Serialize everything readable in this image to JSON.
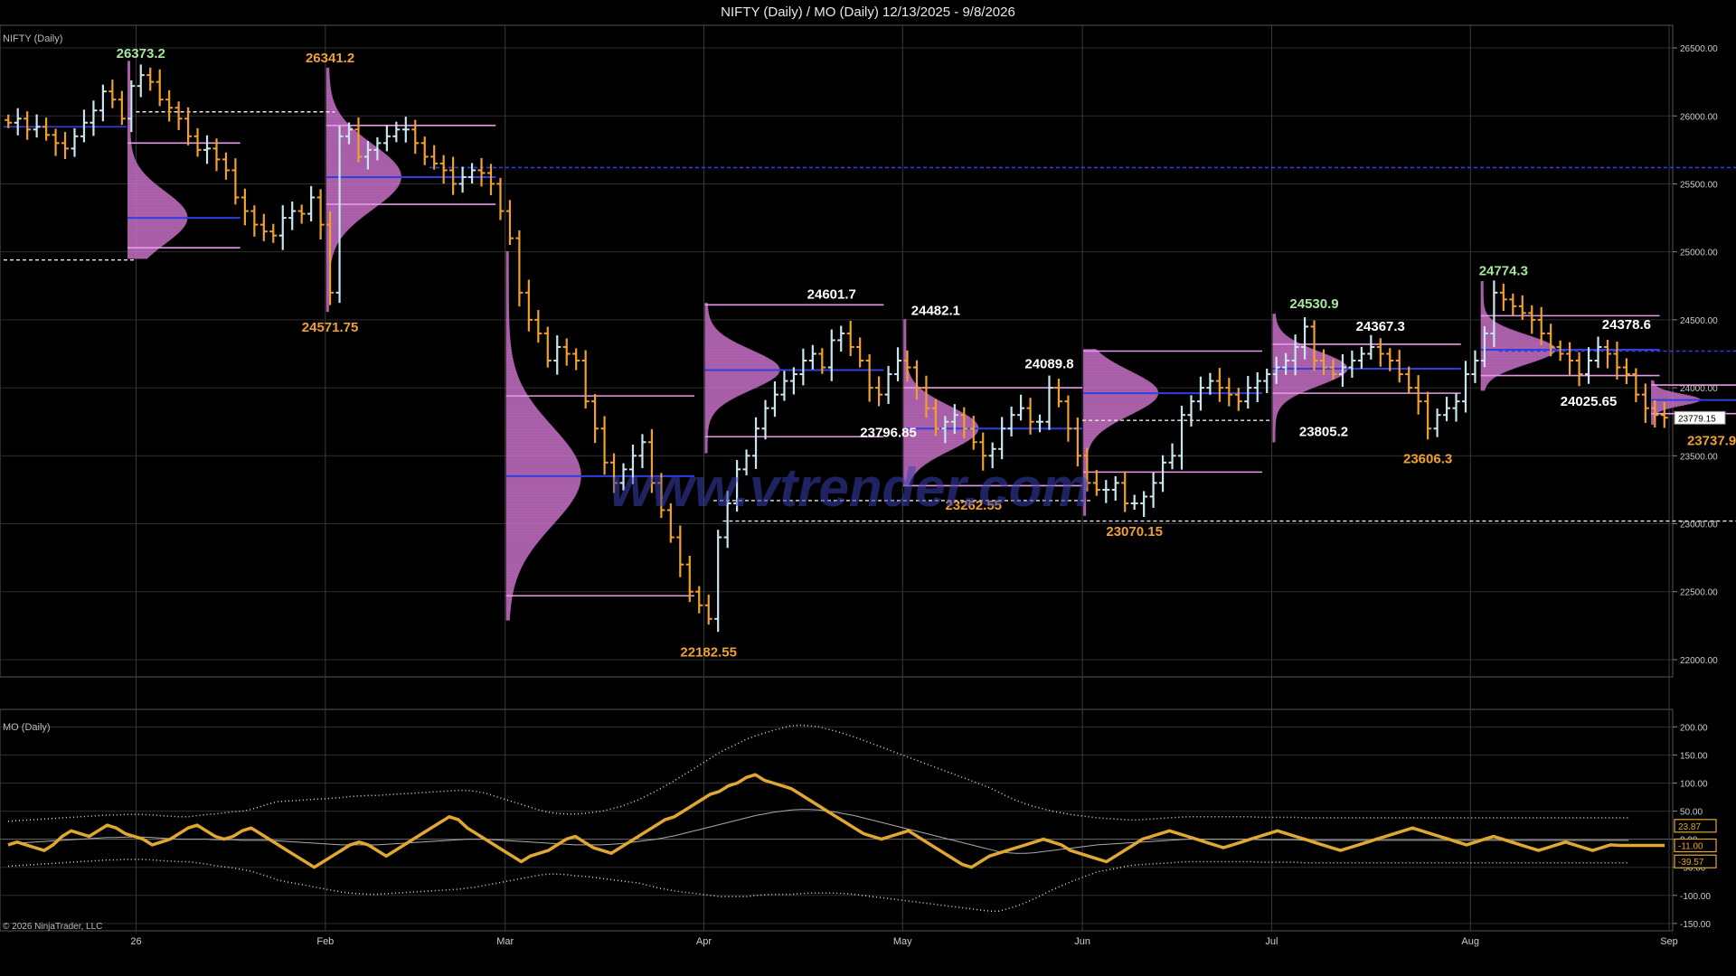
{
  "window": {
    "title": "NIFTY (Daily) / MO (Daily)  12/13/2025 - 9/8/2026"
  },
  "colors": {
    "background": "#000000",
    "grid": "#3a3a3a",
    "bar_up": "#c9e6ee",
    "bar_down": "#f0a030",
    "profile": "#c872c8",
    "poc": "#2f3fe0",
    "value_area": "#e89ae8",
    "mo_line": "#e0a830",
    "mo_band": "#d8d8d8",
    "label_white": "#ffffff",
    "label_orange": "#f0a030",
    "label_green": "#a8e6a0"
  },
  "watermark": "www.vtrender.com",
  "copyright": "© 2026 NinjaTrader, LLC",
  "chart_data": [
    {
      "type": "candlestick",
      "panel_label": "NIFTY (Daily)",
      "ylim": [
        21900,
        26600
      ],
      "y_ticks": [
        "26500.00",
        "26000.00",
        "25500.00",
        "25000.00",
        "24500.00",
        "24000.00",
        "23500.00",
        "23000.00",
        "22500.00",
        "22000.00"
      ],
      "x_ticks": [
        "26",
        "Feb",
        "Mar",
        "Apr",
        "May",
        "Jun",
        "Jul",
        "Aug",
        "Sep"
      ],
      "last_price": "23779.15",
      "annotations": [
        {
          "text": "26373.2",
          "day": 14,
          "price": 26373.2,
          "color": "green",
          "pos": "above"
        },
        {
          "text": "26341.2",
          "day": 34,
          "price": 26341.2,
          "color": "orange",
          "pos": "above"
        },
        {
          "text": "24571.75",
          "day": 34,
          "price": 24571.75,
          "color": "orange",
          "pos": "below"
        },
        {
          "text": "24601.7",
          "day": 87,
          "price": 24601.7,
          "color": "white",
          "pos": "above"
        },
        {
          "text": "24482.1",
          "day": 98,
          "price": 24482.1,
          "color": "white",
          "pos": "above"
        },
        {
          "text": "23796.85",
          "day": 93,
          "price": 23796.85,
          "color": "white",
          "pos": "below"
        },
        {
          "text": "24089.8",
          "day": 110,
          "price": 24089.8,
          "color": "white",
          "pos": "above"
        },
        {
          "text": "23262.55",
          "day": 102,
          "price": 23262.55,
          "color": "orange",
          "pos": "below"
        },
        {
          "text": "22182.55",
          "day": 74,
          "price": 22182.55,
          "color": "orange",
          "pos": "below"
        },
        {
          "text": "23070.15",
          "day": 119,
          "price": 23070.15,
          "color": "orange",
          "pos": "below"
        },
        {
          "text": "24530.9",
          "day": 138,
          "price": 24530.9,
          "color": "green",
          "pos": "above"
        },
        {
          "text": "23805.2",
          "day": 139,
          "price": 23805.2,
          "color": "white",
          "pos": "below"
        },
        {
          "text": "24367.3",
          "day": 145,
          "price": 24367.3,
          "color": "white",
          "pos": "above"
        },
        {
          "text": "23606.3",
          "day": 150,
          "price": 23606.3,
          "color": "orange",
          "pos": "below"
        },
        {
          "text": "24774.3",
          "day": 158,
          "price": 24774.3,
          "color": "green",
          "pos": "above"
        },
        {
          "text": "24378.6",
          "day": 171,
          "price": 24378.6,
          "color": "white",
          "pos": "above"
        },
        {
          "text": "24025.65",
          "day": 167,
          "price": 24025.65,
          "color": "white",
          "pos": "below"
        },
        {
          "text": "23737.9",
          "day": 180,
          "price": 23737.9,
          "color": "orange",
          "pos": "below"
        }
      ],
      "profiles": [
        {
          "d0": 13,
          "d1": 24,
          "hi": 26400,
          "lo": 24950,
          "poc": 25250,
          "vah": 25800,
          "val": 25030
        },
        {
          "d0": 34,
          "d1": 51,
          "hi": 26350,
          "lo": 24560,
          "poc": 25550,
          "vah": 25930,
          "val": 25350
        },
        {
          "d0": 53,
          "d1": 72,
          "hi": 25000,
          "lo": 22290,
          "poc": 23350,
          "vah": 23940,
          "val": 22470
        },
        {
          "d0": 74,
          "d1": 92,
          "hi": 24620,
          "lo": 23520,
          "poc": 24130,
          "vah": 24610,
          "val": 23640
        },
        {
          "d0": 95,
          "d1": 113,
          "hi": 24500,
          "lo": 23280,
          "poc": 23700,
          "vah": 24000,
          "val": 23280
        },
        {
          "d0": 114,
          "d1": 132,
          "hi": 24280,
          "lo": 23060,
          "poc": 23960,
          "vah": 24270,
          "val": 23380
        },
        {
          "d0": 134,
          "d1": 153,
          "hi": 24540,
          "lo": 23600,
          "poc": 24140,
          "vah": 24320,
          "val": 23960
        },
        {
          "d0": 156,
          "d1": 174,
          "hi": 24780,
          "lo": 23980,
          "poc": 24280,
          "vah": 24530,
          "val": 24090
        },
        {
          "d0": 174,
          "d1": 183,
          "hi": 24050,
          "lo": 23730,
          "poc": 23910,
          "vah": 24020,
          "val": 23810
        }
      ],
      "blue_levels": [
        {
          "d0": 0,
          "d1": 12,
          "price": 25920
        },
        {
          "d0": 45,
          "d1": 183,
          "price": 25620,
          "dashed": true
        },
        {
          "d0": 158,
          "d1": 183,
          "price": 24270,
          "dashed": true
        }
      ],
      "dashed_levels": [
        {
          "d0": 0,
          "d1": 13,
          "price": 24940
        },
        {
          "d0": 14,
          "d1": 34,
          "price": 26030
        },
        {
          "d0": 75,
          "d1": 114,
          "price": 23170
        },
        {
          "d0": 76,
          "d1": 183,
          "price": 23020
        },
        {
          "d0": 114,
          "d1": 133,
          "price": 23760
        }
      ],
      "closes": [
        25950,
        25980,
        25900,
        25920,
        25860,
        25800,
        25760,
        25850,
        25950,
        26040,
        26180,
        26120,
        25980,
        26220,
        26300,
        26250,
        26120,
        26060,
        25980,
        25850,
        25750,
        25760,
        25680,
        25600,
        25400,
        25300,
        25200,
        25150,
        25120,
        25250,
        25300,
        25280,
        25400,
        25200,
        24700,
        25850,
        25900,
        25700,
        25750,
        25800,
        25850,
        25900,
        25900,
        25800,
        25700,
        25650,
        25600,
        25500,
        25550,
        25600,
        25580,
        25500,
        25300,
        25100,
        24700,
        24500,
        24400,
        24200,
        24300,
        24250,
        24200,
        23900,
        23700,
        23450,
        23300,
        23400,
        23500,
        23600,
        23300,
        23100,
        22900,
        22700,
        22500,
        22400,
        22300,
        22900,
        23150,
        23400,
        23500,
        23700,
        23850,
        23950,
        24050,
        24100,
        24200,
        24250,
        24150,
        24350,
        24400,
        24300,
        24200,
        24000,
        23950,
        24100,
        24200,
        24150,
        24000,
        23850,
        23700,
        23750,
        23800,
        23700,
        23600,
        23500,
        23550,
        23700,
        23800,
        23850,
        23750,
        23750,
        24000,
        23900,
        23700,
        23500,
        23300,
        23250,
        23250,
        23300,
        23150,
        23150,
        23200,
        23300,
        23450,
        23500,
        23800,
        23900,
        24000,
        24050,
        24000,
        23950,
        23900,
        24000,
        24050,
        24100,
        24150,
        24200,
        24300,
        24450,
        24200,
        24150,
        24100,
        24150,
        24200,
        24250,
        24300,
        24250,
        24200,
        24100,
        24000,
        23900,
        23700,
        23800,
        23850,
        23900,
        24100,
        24200,
        24400,
        24700,
        24650,
        24600,
        24550,
        24500,
        24400,
        24300,
        24250,
        24200,
        24100,
        24200,
        24300,
        24250,
        24150,
        24100,
        23950,
        23850,
        23800,
        23780
      ]
    },
    {
      "type": "line",
      "panel_label": "MO (Daily)",
      "ylim": [
        -155,
        215
      ],
      "y_ticks": [
        "200.00",
        "150.00",
        "100.00",
        "50.00",
        "0.00",
        "-50.00",
        "-100.00",
        "-150.00"
      ],
      "markers": [
        {
          "text": "23.87",
          "value": 23.87,
          "color": "#e0a830"
        },
        {
          "text": "-11.00",
          "value": -11,
          "color": "#e0a830"
        },
        {
          "text": "-39.57",
          "value": -39.57,
          "color": "#e0a830"
        }
      ],
      "mo_values": [
        -10,
        -5,
        -10,
        -15,
        -20,
        -10,
        5,
        15,
        10,
        5,
        15,
        25,
        20,
        10,
        5,
        0,
        -10,
        -5,
        0,
        10,
        20,
        25,
        15,
        5,
        0,
        5,
        15,
        20,
        10,
        0,
        -10,
        -20,
        -30,
        -40,
        -50,
        -40,
        -30,
        -20,
        -10,
        -5,
        -10,
        -20,
        -30,
        -20,
        -10,
        0,
        10,
        20,
        30,
        40,
        35,
        20,
        10,
        0,
        -10,
        -20,
        -30,
        -40,
        -30,
        -25,
        -20,
        -10,
        0,
        5,
        -5,
        -15,
        -20,
        -25,
        -15,
        -5,
        5,
        15,
        25,
        35,
        40,
        50,
        60,
        70,
        80,
        85,
        95,
        100,
        110,
        115,
        105,
        100,
        95,
        90,
        80,
        70,
        60,
        50,
        40,
        30,
        20,
        10,
        5,
        0,
        5,
        10,
        15,
        5,
        -5,
        -15,
        -25,
        -35,
        -45,
        -50,
        -40,
        -30,
        -25,
        -20,
        -15,
        -10,
        -5,
        0,
        -5,
        -10,
        -20,
        -25,
        -30,
        -35,
        -40,
        -30,
        -20,
        -10,
        0,
        5,
        10,
        15,
        10,
        5,
        0,
        -5,
        -10,
        -15,
        -10,
        -5,
        0,
        5,
        10,
        15,
        10,
        5,
        0,
        -5,
        -10,
        -15,
        -20,
        -15,
        -10,
        -5,
        0,
        5,
        10,
        15,
        20,
        15,
        10,
        5,
        0,
        -5,
        -10,
        -5,
        0,
        5,
        0,
        -5,
        -10,
        -15,
        -20,
        -15,
        -10,
        -5,
        -10,
        -15,
        -20,
        -15,
        -10,
        -11,
        -11,
        -11,
        -11,
        -11,
        -11
      ],
      "avg_values": [
        -8,
        -7,
        -6,
        -5,
        -4,
        -3,
        -2,
        -1,
        0,
        1,
        2,
        3,
        3,
        4,
        4,
        4,
        3,
        2,
        1,
        0,
        0,
        0,
        0,
        -1,
        -1,
        -1,
        -2,
        -2,
        -2,
        -2,
        -3,
        -4,
        -5,
        -6,
        -7,
        -8,
        -9,
        -10,
        -10,
        -10,
        -10,
        -10,
        -9,
        -8,
        -7,
        -6,
        -5,
        -4,
        -3,
        -2,
        -1,
        0,
        0,
        0,
        -1,
        -2,
        -3,
        -4,
        -5,
        -6,
        -7,
        -8,
        -9,
        -10,
        -10,
        -10,
        -10,
        -9,
        -8,
        -6,
        -4,
        -2,
        0,
        3,
        6,
        10,
        14,
        18,
        22,
        26,
        30,
        34,
        38,
        42,
        45,
        48,
        50,
        52,
        53,
        53,
        52,
        50,
        48,
        45,
        42,
        38,
        34,
        30,
        26,
        22,
        18,
        14,
        10,
        6,
        2,
        -2,
        -6,
        -10,
        -14,
        -18,
        -22,
        -24,
        -25,
        -25,
        -24,
        -22,
        -20,
        -18,
        -16,
        -14,
        -12,
        -10,
        -9,
        -8,
        -7,
        -6,
        -5,
        -4,
        -3,
        -2,
        -1,
        0,
        0,
        0,
        0,
        0,
        0,
        0,
        0,
        -1,
        -1,
        -1,
        -1,
        -1,
        -2,
        -2,
        -2,
        -2,
        -2,
        -2,
        -2,
        -2,
        -2,
        -2,
        -2,
        -2,
        -2,
        -2,
        -2,
        -2,
        -2,
        -2,
        -2,
        -2,
        -2,
        -2,
        -2,
        -2,
        -2,
        -2,
        -2,
        -2,
        -2,
        -2,
        -2,
        -2,
        -2,
        -2,
        -2,
        -2,
        -2
      ],
      "band_half_width": [
        40,
        40,
        40,
        40,
        40,
        40,
        40,
        40,
        40,
        40,
        40,
        40,
        40,
        40,
        40,
        40,
        40,
        40,
        40,
        40,
        40,
        42,
        44,
        46,
        48,
        50,
        52,
        55,
        60,
        65,
        70,
        72,
        74,
        76,
        78,
        80,
        82,
        84,
        86,
        87,
        88,
        88,
        88,
        88,
        88,
        88,
        88,
        88,
        88,
        88,
        88,
        87,
        85,
        82,
        78,
        74,
        70,
        66,
        62,
        58,
        55,
        54,
        54,
        55,
        56,
        58,
        60,
        63,
        66,
        70,
        74,
        80,
        86,
        92,
        98,
        104,
        110,
        116,
        122,
        128,
        132,
        136,
        140,
        142,
        144,
        146,
        148,
        150,
        150,
        149,
        148,
        146,
        144,
        142,
        140,
        138,
        136,
        134,
        132,
        130,
        128,
        126,
        124,
        122,
        120,
        118,
        116,
        114,
        112,
        110,
        106,
        100,
        94,
        88,
        82,
        76,
        70,
        65,
        60,
        56,
        52,
        48,
        46,
        44,
        42,
        40,
        40,
        40,
        40,
        40,
        40,
        40,
        40,
        40,
        40,
        40,
        40,
        40,
        40,
        40,
        40,
        40,
        40,
        40,
        40,
        40,
        40,
        40,
        40,
        40,
        40,
        40,
        40,
        40,
        40,
        40,
        40,
        40,
        40,
        40,
        40,
        40,
        40,
        40,
        40,
        40,
        40,
        40,
        40,
        40,
        40,
        40,
        40,
        40,
        40,
        40,
        40,
        40,
        40,
        40,
        40,
        40,
        40
      ]
    }
  ]
}
